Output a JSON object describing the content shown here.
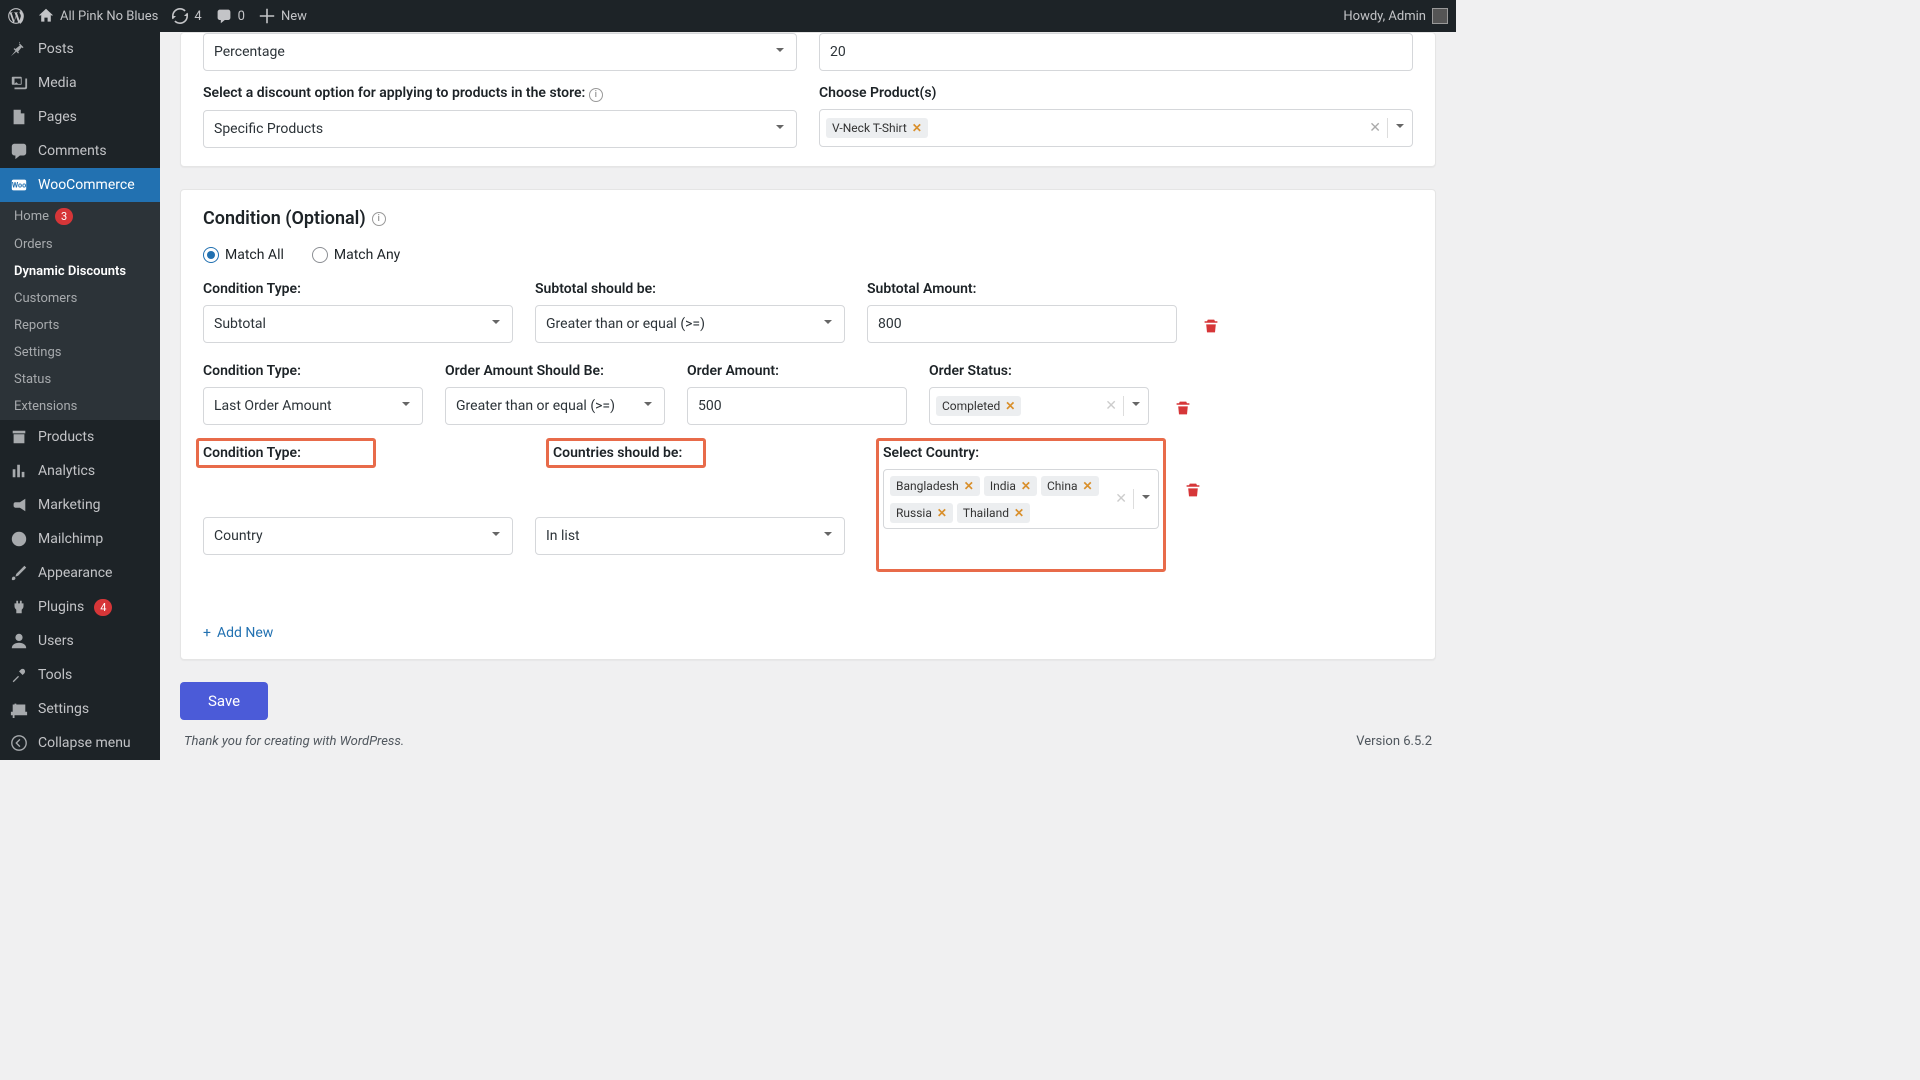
{
  "adminbar": {
    "site_name": "All Pink No Blues",
    "updates": "4",
    "comments": "0",
    "new_label": "New",
    "howdy": "Howdy, Admin"
  },
  "sidebar": {
    "posts": "Posts",
    "media": "Media",
    "pages": "Pages",
    "comments": "Comments",
    "woocommerce": "WooCommerce",
    "woo_sub": {
      "home": "Home",
      "home_badge": "3",
      "orders": "Orders",
      "dynamic_discounts": "Dynamic Discounts",
      "customers": "Customers",
      "reports": "Reports",
      "settings": "Settings",
      "status": "Status",
      "extensions": "Extensions"
    },
    "products": "Products",
    "analytics": "Analytics",
    "marketing": "Marketing",
    "mailchimp": "Mailchimp",
    "appearance": "Appearance",
    "plugins": "Plugins",
    "plugins_badge": "4",
    "users": "Users",
    "tools": "Tools",
    "settings_main": "Settings",
    "collapse": "Collapse menu"
  },
  "card1": {
    "percentage": "Percentage",
    "percentage_val": "20",
    "discount_option_label": "Select a discount option for applying to products in the store:",
    "discount_option_val": "Specific Products",
    "choose_products_label": "Choose Product(s)",
    "product_tag": "V-Neck T-Shirt"
  },
  "card2": {
    "title": "Condition (Optional)",
    "match_all": "Match All",
    "match_any": "Match Any",
    "cond_type_label": "Condition Type:",
    "r1": {
      "type_val": "Subtotal",
      "subtotal_should_label": "Subtotal should be:",
      "subtotal_should_val": "Greater than or equal (>=)",
      "subtotal_amount_label": "Subtotal Amount:",
      "subtotal_amount_val": "800"
    },
    "r2": {
      "type_val": "Last Order Amount",
      "order_should_label": "Order Amount Should Be:",
      "order_should_val": "Greater than or equal (>=)",
      "order_amount_label": "Order Amount:",
      "order_amount_val": "500",
      "order_status_label": "Order Status:",
      "status_tag": "Completed"
    },
    "r3": {
      "type_val": "Country",
      "countries_should_label": "Countries should be:",
      "countries_should_val": "In list",
      "select_country_label": "Select Country:",
      "countries": [
        "Bangladesh",
        "India",
        "China",
        "Russia",
        "Thailand"
      ]
    },
    "add_new": "Add New"
  },
  "save_label": "Save",
  "footer": {
    "thanks": "Thank you for creating with WordPress.",
    "version": "Version 6.5.2"
  }
}
